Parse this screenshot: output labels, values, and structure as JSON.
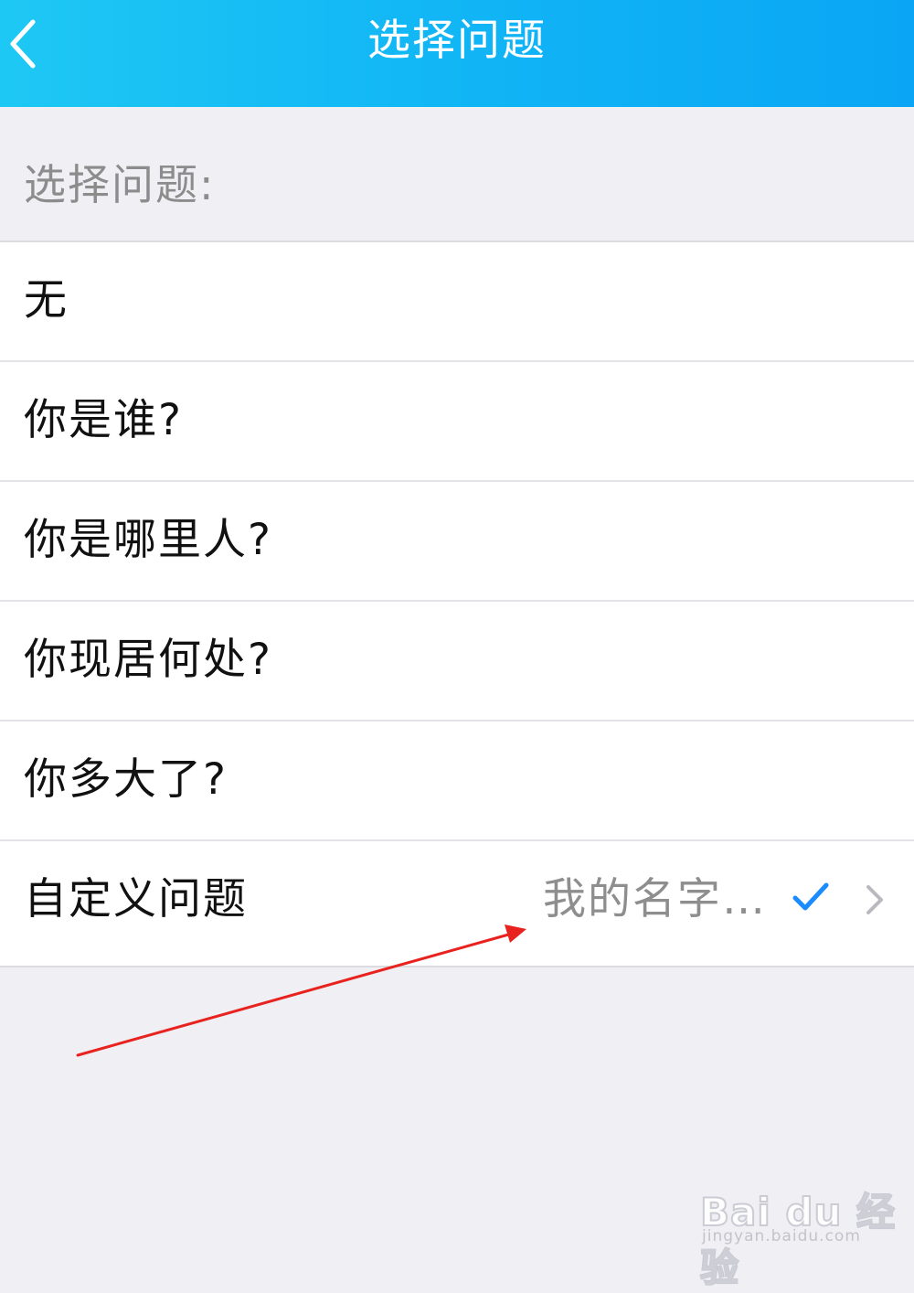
{
  "header": {
    "title": "选择问题",
    "back_icon": "chevron-left-icon"
  },
  "section_label": "选择问题:",
  "options": [
    {
      "label": "无"
    },
    {
      "label": "你是谁?"
    },
    {
      "label": "你是哪里人?"
    },
    {
      "label": "你现居何处?"
    },
    {
      "label": "你多大了?"
    },
    {
      "label": "自定义问题",
      "value": "我的名字…",
      "selected": true
    }
  ],
  "colors": {
    "header_start": "#1ec8f4",
    "header_end": "#0aa6f5",
    "check": "#1a8cff",
    "annotation_arrow": "#e8231f"
  },
  "watermark": {
    "logo": "Bai du 经验",
    "url": "jingyan.baidu.com"
  }
}
